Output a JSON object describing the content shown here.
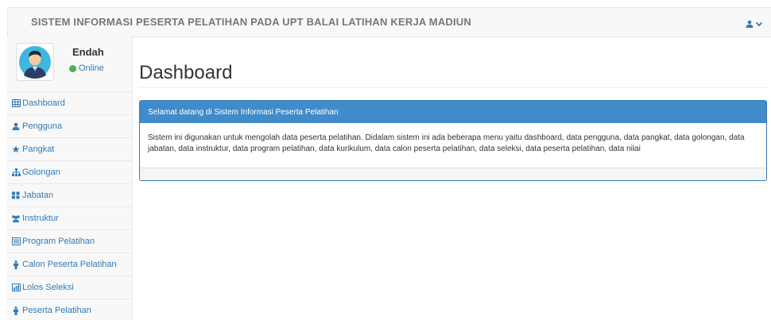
{
  "header": {
    "title": "SISTEM INFORMASI PESERTA PELATIHAN PADA UPT BALAI LATIHAN KERJA MADIUN",
    "user_icon": "user-icon",
    "dropdown_icon": "chevron-down-icon"
  },
  "profile": {
    "name": "Endah",
    "status": "Online",
    "status_color": "#4caf50"
  },
  "sidebar": {
    "items": [
      {
        "label": "Dashboard",
        "icon": "table-icon"
      },
      {
        "label": "Pengguna",
        "icon": "user-icon"
      },
      {
        "label": "Pangkat",
        "icon": "star-icon"
      },
      {
        "label": "Golongan",
        "icon": "sitemap-icon"
      },
      {
        "label": "Jabatan",
        "icon": "grid-icon"
      },
      {
        "label": "Instruktur",
        "icon": "users-icon"
      },
      {
        "label": "Program Pelatihan",
        "icon": "list-alt-icon"
      },
      {
        "label": "Calon Peserta Pelatihan",
        "icon": "person-icon"
      },
      {
        "label": "Lolos Seleksi",
        "icon": "bar-chart-icon"
      },
      {
        "label": "Peserta Pelatihan",
        "icon": "person-icon"
      }
    ]
  },
  "main": {
    "page_title": "Dashboard",
    "panel": {
      "heading": "Selamat datang di Sistem Informasi Peserta Pelatihan",
      "body": "Sistem ini digunakan untuk mengolah data peserta pelatihan. Didalam sistem ini ada beberapa menu yaitu dashboard, data pengguna, data pangkat, data golongan, data jabatan, data instruktur, data program pelatihan, data kurikulum, data calon peserta pelatihan, data seleksi, data peserta pelatihan, data nilai"
    }
  },
  "colors": {
    "link": "#337ab7",
    "panel_heading": "#428bca",
    "online": "#4caf50"
  }
}
